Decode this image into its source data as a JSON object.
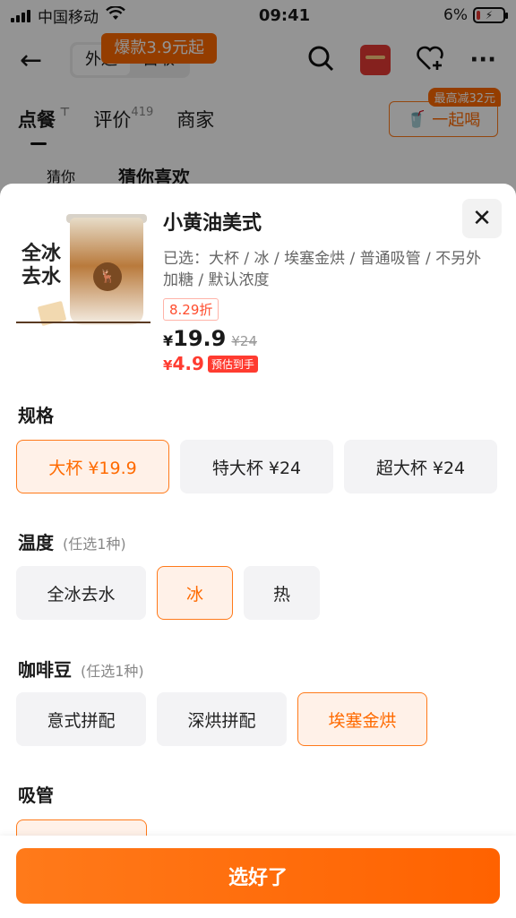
{
  "status_bar": {
    "carrier": "中国移动",
    "time": "09:41",
    "battery": "6%"
  },
  "nav": {
    "delivery_tab": "外送",
    "pickup_tab": "自取",
    "promo_tag": "爆款3.9元起"
  },
  "tabs": {
    "order": "点餐",
    "reviews": "评价",
    "review_count": "419",
    "merchant": "商家",
    "group_order": "一起喝",
    "group_tag": "最高减32元"
  },
  "background": {
    "guess_label": "猜你",
    "guess_title": "猜你喜欢"
  },
  "product": {
    "image_text": "全冰去水",
    "name": "小黄油美式",
    "selected_text": "已选：大杯 / 冰 / 埃塞金烘 / 普通吸管 / 不另外加糖 / 默认浓度",
    "discount_tag": "8.29折",
    "currency": "¥",
    "price": "19.9",
    "original_price": "¥24",
    "estimated_price": "4.9",
    "estimated_tag": "预估到手"
  },
  "sections": {
    "size": {
      "title": "规格",
      "options": [
        "大杯 ¥19.9",
        "特大杯 ¥24",
        "超大杯 ¥24"
      ],
      "selected": 0
    },
    "temperature": {
      "title": "温度",
      "hint": "(任选1种)",
      "options": [
        "全冰去水",
        "冰",
        "热"
      ],
      "selected": 1
    },
    "beans": {
      "title": "咖啡豆",
      "hint": "(任选1种)",
      "options": [
        "意式拼配",
        "深烘拼配",
        "埃塞金烘"
      ],
      "selected": 2
    },
    "straw": {
      "title": "吸管"
    }
  },
  "confirm_button": "选好了",
  "colors": {
    "accent": "#ff6a00",
    "price_red": "#ff3b30"
  }
}
